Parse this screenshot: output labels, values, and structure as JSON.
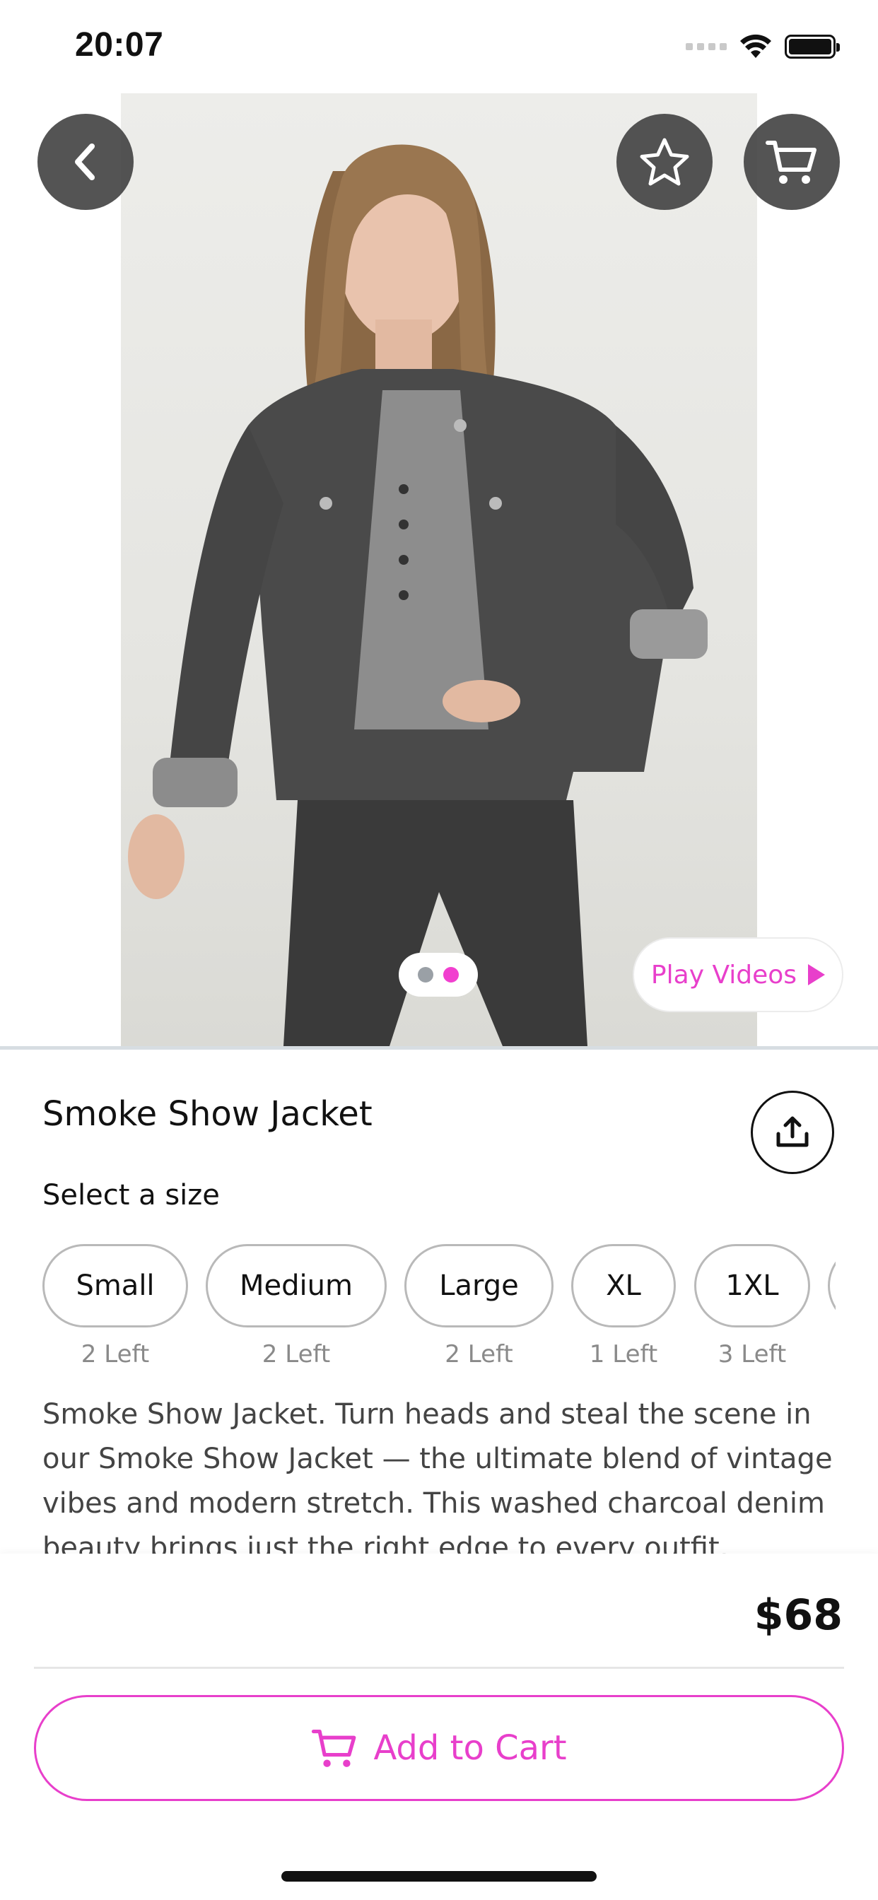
{
  "status_bar": {
    "time": "20:07"
  },
  "hero": {
    "image_alt": "Model wearing washed charcoal denim jacket",
    "carousel": {
      "total": 2,
      "active_index": 1
    },
    "play_videos_label": "Play Videos"
  },
  "icons": {
    "back": "chevron-left-icon",
    "favorite": "star-icon",
    "cart": "cart-icon",
    "share": "share-icon",
    "play": "play-icon"
  },
  "product": {
    "title": "Smoke Show Jacket",
    "size_heading": "Select a size",
    "sizes": [
      {
        "label": "Small",
        "stock": "2 Left"
      },
      {
        "label": "Medium",
        "stock": "2 Left"
      },
      {
        "label": "Large",
        "stock": "2 Left"
      },
      {
        "label": "XL",
        "stock": "1 Left"
      },
      {
        "label": "1XL",
        "stock": "3 Left"
      }
    ],
    "description": "Smoke Show Jacket. Turn heads and steal the scene in our Smoke Show Jacket — the ultimate blend of vintage vibes and modern stretch. This washed charcoal denim beauty brings just the right edge to every outfit, whether"
  },
  "checkout": {
    "price": "$68",
    "add_to_cart_label": "Add to Cart"
  },
  "colors": {
    "accent": "#e83fcb",
    "control_dark": "#3c3c3c",
    "dot_inactive": "#9aa0a6"
  }
}
